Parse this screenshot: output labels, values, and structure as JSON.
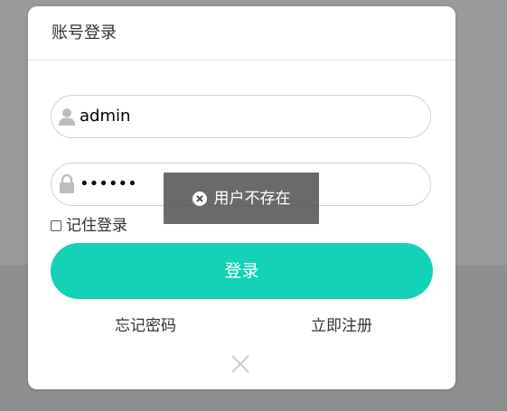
{
  "modal": {
    "title": "账号登录",
    "username": {
      "value": "admin",
      "icon": "user-icon"
    },
    "password": {
      "value": "••••••",
      "icon": "lock-icon"
    },
    "remember_label": "记住登录",
    "login_label": "登录",
    "forgot_label": "忘记密码",
    "register_label": "立即注册",
    "close_icon": "close-icon"
  },
  "toast": {
    "text": "用户不存在",
    "icon": "error-circle-icon"
  },
  "colors": {
    "accent": "#13d2b7",
    "backdrop": "#8f8f8f",
    "toast_bg": "#505050"
  }
}
